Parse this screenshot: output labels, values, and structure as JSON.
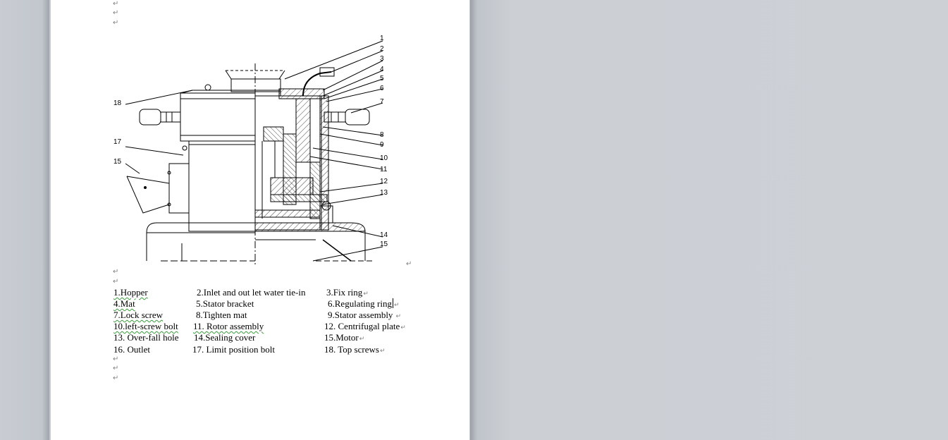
{
  "document": {
    "paragraph_mark": "↵",
    "figure_callouts": [
      "1",
      "2",
      "3",
      "4",
      "5",
      "6",
      "7",
      "8",
      "9",
      "10",
      "11",
      "12",
      "13",
      "14",
      "15",
      "16",
      "17",
      "18"
    ],
    "legend": [
      [
        "1.Hopper",
        "2.Inlet and out let water tie-in",
        "3.Fix ring"
      ],
      [
        "4.Mat",
        "5.Stator bracket",
        "6.Regulating ring"
      ],
      [
        "7.Lock screw",
        "8.Tighten mat",
        "9.Stator assembly"
      ],
      [
        "10.left-screw bolt",
        "11. Rotor assembly",
        "12. Centrifugal plate"
      ],
      [
        "13. Over-fall hole",
        "14.Sealing cover",
        "15.Motor"
      ],
      [
        "16. Outlet",
        "17. Limit position bolt",
        "18. Top screws"
      ]
    ]
  }
}
